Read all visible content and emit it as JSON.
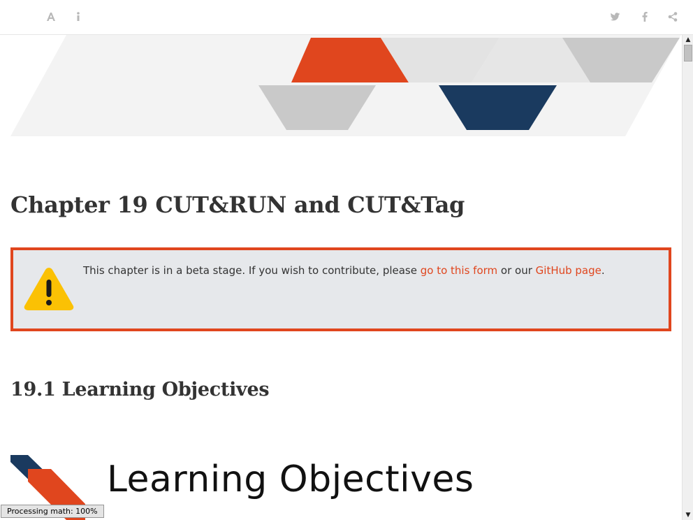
{
  "toolbar": {
    "font_settings_icon": "font-icon",
    "info_icon": "info-icon",
    "twitter_icon": "twitter-icon",
    "facebook_icon": "facebook-icon",
    "share_icon": "share-icon"
  },
  "chapter": {
    "title": "Chapter 19   CUT&RUN and CUT&Tag"
  },
  "callout": {
    "icon": "warning-icon",
    "text_before": "This chapter is in a beta stage. If you wish to contribute, please ",
    "link1_label": "go to this form",
    "text_middle": " or our ",
    "link2_label": "GitHub page",
    "text_after": "."
  },
  "section": {
    "title": "19.1   Learning Objectives"
  },
  "banner": {
    "title": "Learning Objectives"
  },
  "status": {
    "text": "Processing math: 100%"
  },
  "colors": {
    "accent_orange": "#e0461e",
    "accent_navy": "#1a3a5f",
    "callout_bg": "#e6e8eb",
    "warning_yellow": "#fbc104"
  }
}
